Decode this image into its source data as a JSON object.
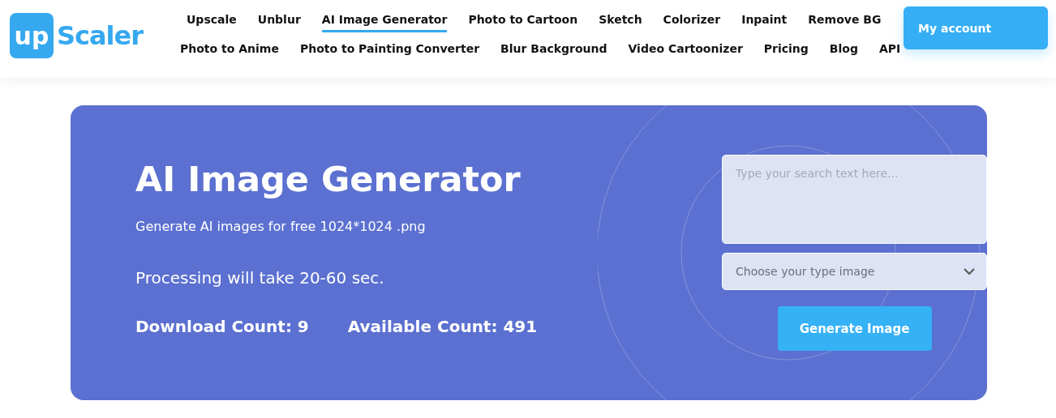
{
  "logo": {
    "mark": "up",
    "name": "Scaler"
  },
  "nav_rows": [
    [
      {
        "label": "Upscale",
        "selected": false
      },
      {
        "label": "Unblur",
        "selected": false
      },
      {
        "label": "AI Image Generator",
        "selected": true
      },
      {
        "label": "Photo to Cartoon",
        "selected": false
      },
      {
        "label": "Sketch",
        "selected": false
      },
      {
        "label": "Colorizer",
        "selected": false
      },
      {
        "label": "Inpaint",
        "selected": false
      },
      {
        "label": "Remove BG",
        "selected": false
      }
    ],
    [
      {
        "label": "Photo to Anime",
        "selected": false
      },
      {
        "label": "Photo to Painting Converter",
        "selected": false
      },
      {
        "label": "Blur Background",
        "selected": false
      },
      {
        "label": "Video Cartoonizer",
        "selected": false
      },
      {
        "label": "Pricing",
        "selected": false
      },
      {
        "label": "Blog",
        "selected": false
      },
      {
        "label": "API",
        "selected": false
      }
    ]
  ],
  "account_button": "My account",
  "hero": {
    "title": "AI Image Generator",
    "subtitle": "Generate AI images for free 1024*1024 .png",
    "processing": "Processing will take 20-60 sec.",
    "counts": [
      {
        "label": "Download Count: 9"
      },
      {
        "label": "Available Count: 491"
      }
    ],
    "prompt": {
      "placeholder": "Type your search text here..."
    },
    "type_select": {
      "placeholder": "Choose your type image"
    },
    "generate_button": "Generate Image"
  }
}
